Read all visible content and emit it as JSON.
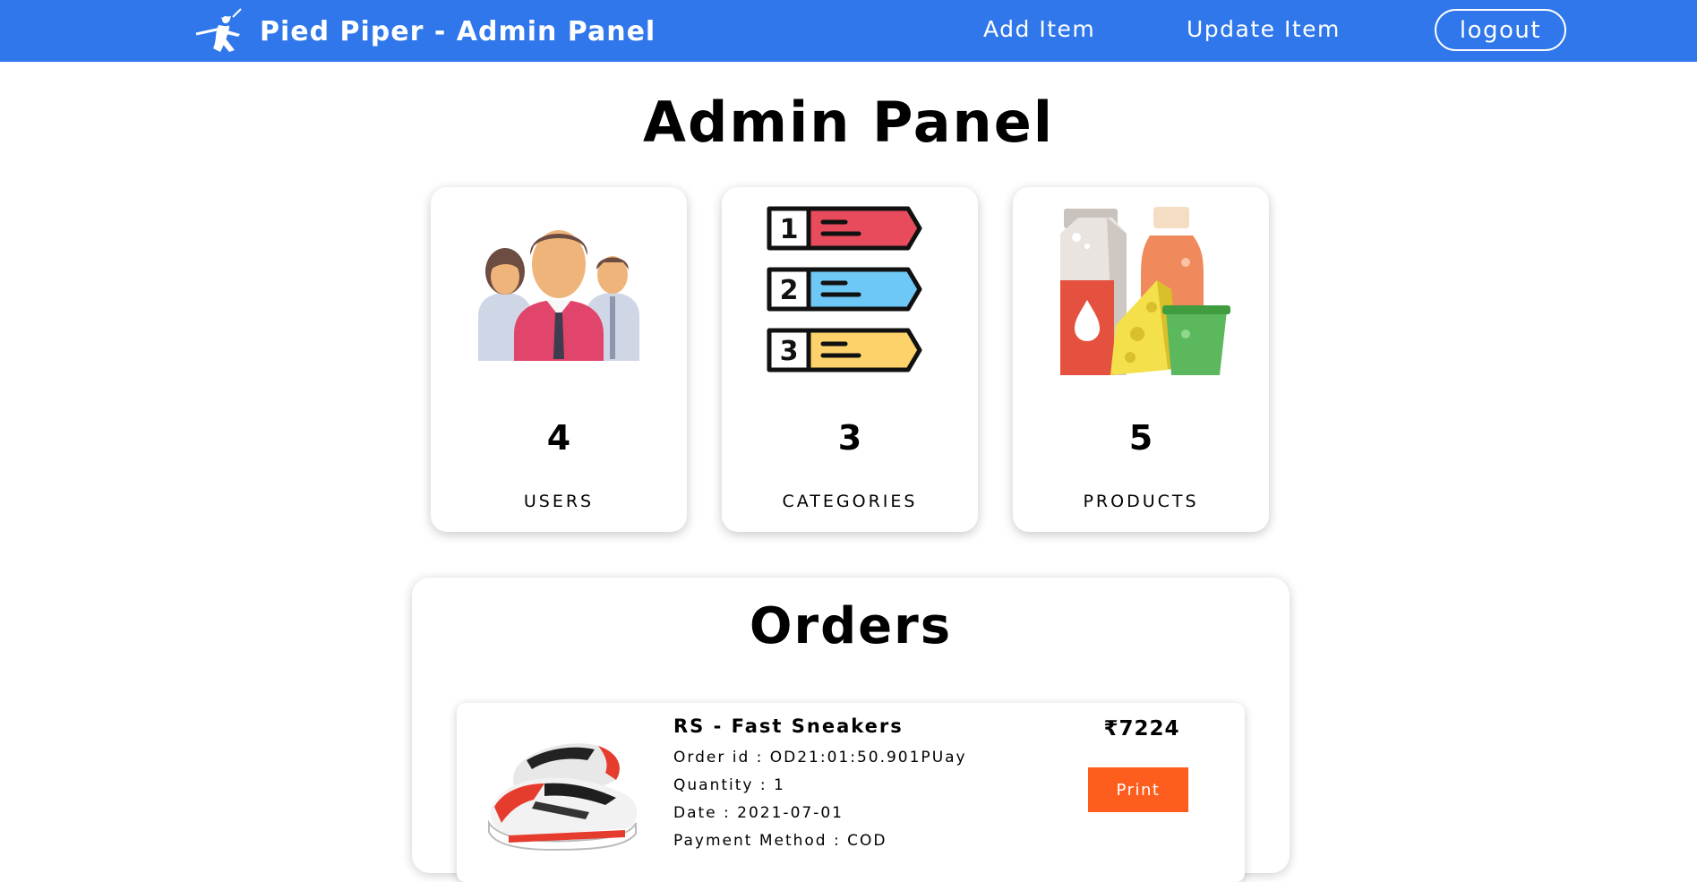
{
  "nav": {
    "brand_logo_icon": "pied-piper-flute-player-icon",
    "brand_title": "Pied Piper - Admin Panel",
    "add_item": "Add Item",
    "update_item": "Update Item",
    "logout": "logout",
    "bar_color": "#2f77ea"
  },
  "page": {
    "title": "Admin Panel"
  },
  "stats": [
    {
      "icon": "users-group-icon",
      "count": "4",
      "label": "USERS"
    },
    {
      "icon": "numbered-list-icon",
      "count": "3",
      "label": "CATEGORIES"
    },
    {
      "icon": "grocery-products-icon",
      "count": "5",
      "label": "PRODUCTS"
    }
  ],
  "orders": {
    "title": "Orders",
    "items": [
      {
        "image_icon": "sneaker-shoe-image",
        "name": "RS - Fast Sneakers",
        "order_id": "Order id : OD21:01:50.901PUay",
        "quantity": "Quantity : 1",
        "date": "Date : 2021-07-01",
        "payment": "Payment Method : COD",
        "price": "₹7224",
        "print_label": "Print",
        "print_color": "#fd5e1e"
      }
    ]
  }
}
